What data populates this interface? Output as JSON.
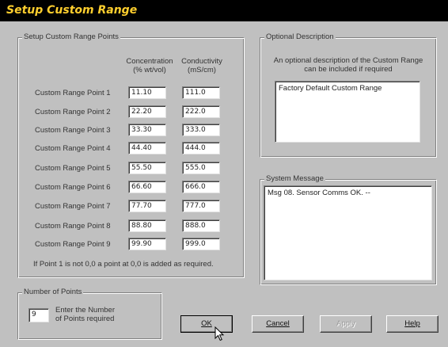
{
  "window": {
    "title": "Setup Custom Range"
  },
  "points_group": {
    "label": "Setup Custom Range Points",
    "col_concentration": "Concentration (% wt/vol)",
    "col_conductivity": "Conductivity (mS/cm)",
    "rows": [
      {
        "label": "Custom Range Point 1",
        "concentration": "11.10",
        "conductivity": "111.0"
      },
      {
        "label": "Custom Range Point 2",
        "concentration": "22.20",
        "conductivity": "222.0"
      },
      {
        "label": "Custom Range Point 3",
        "concentration": "33.30",
        "conductivity": "333.0"
      },
      {
        "label": "Custom Range Point 4",
        "concentration": "44.40",
        "conductivity": "444.0"
      },
      {
        "label": "Custom Range Point 5",
        "concentration": "55.50",
        "conductivity": "555.0"
      },
      {
        "label": "Custom Range Point 6",
        "concentration": "66.60",
        "conductivity": "666.0"
      },
      {
        "label": "Custom Range Point 7",
        "concentration": "77.70",
        "conductivity": "777.0"
      },
      {
        "label": "Custom Range Point 8",
        "concentration": "88.80",
        "conductivity": "888.0"
      },
      {
        "label": "Custom Range Point 9",
        "concentration": "99.90",
        "conductivity": "999.0"
      }
    ],
    "note": "If Point 1 is not 0,0 a point at 0,0 is added as required."
  },
  "description_group": {
    "label": "Optional Description",
    "help": "An optional description of the Custom Range can be included if required",
    "value": "Factory Default Custom Range"
  },
  "system_message": {
    "label": "System Message",
    "value": "Msg 08. Sensor Comms OK. --"
  },
  "num_points": {
    "label": "Number of Points",
    "value": "9",
    "help": "Enter the Number of Points required"
  },
  "buttons": {
    "ok": "OK",
    "cancel": "Cancel",
    "apply": "Apply",
    "help": "Help"
  },
  "colors": {
    "title_bg": "#000000",
    "title_text": "#ffcf2e",
    "face": "#c0c0c0"
  }
}
